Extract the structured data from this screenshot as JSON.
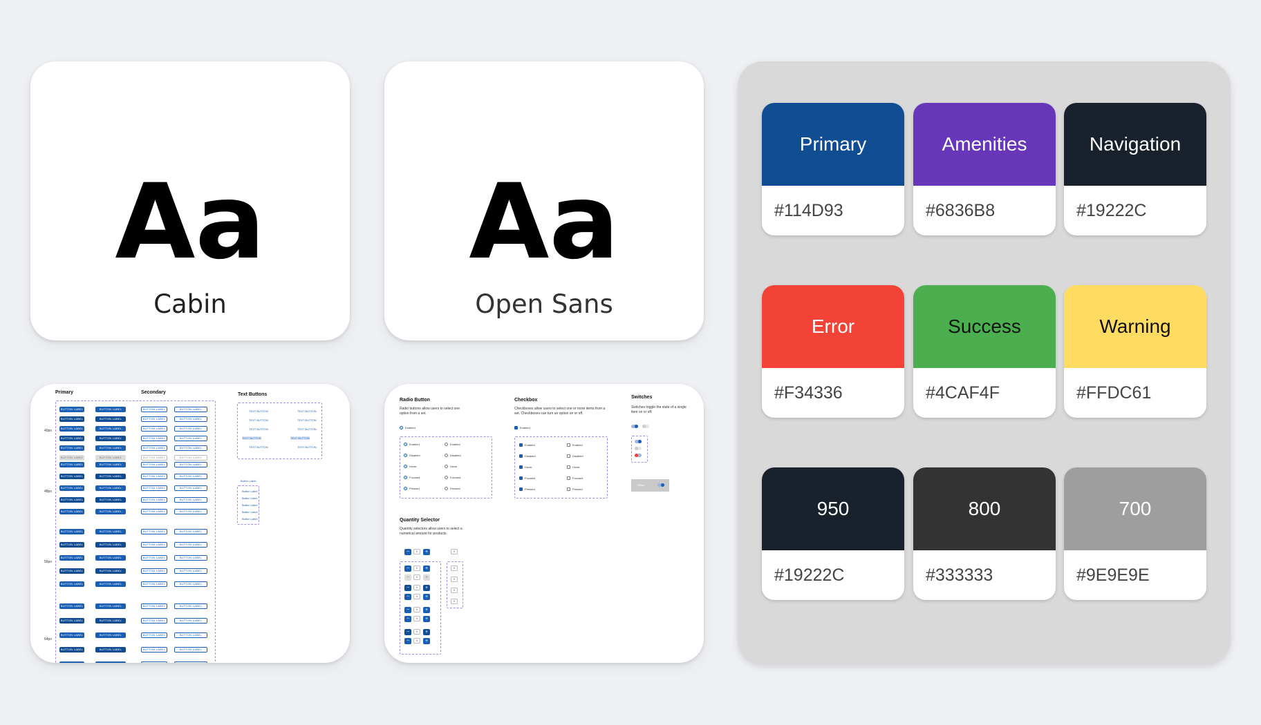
{
  "fonts": [
    {
      "sample": "Aa",
      "name": "Cabin"
    },
    {
      "sample": "Aa",
      "name": "Open Sans"
    }
  ],
  "colors": [
    {
      "name": "Primary",
      "hex": "#114D93",
      "bg": "#114D93",
      "fg": "#FFFFFF"
    },
    {
      "name": "Amenities",
      "hex": "#6836B8",
      "bg": "#6836B8",
      "fg": "#FFFFFF"
    },
    {
      "name": "Navigation",
      "hex": "#19222C",
      "bg": "#19222C",
      "fg": "#FFFFFF"
    },
    {
      "name": "Error",
      "hex": "#F34336",
      "bg": "#F34336",
      "fg": "#FFFFFF"
    },
    {
      "name": "Success",
      "hex": "#4CAF4F",
      "bg": "#4CAF4F",
      "fg": "#111111"
    },
    {
      "name": "Warning",
      "hex": "#FFDC61",
      "bg": "#FFDC61",
      "fg": "#111111"
    },
    {
      "name": "950",
      "hex": "#19222C",
      "bg": "#19222C",
      "fg": "#FFFFFF"
    },
    {
      "name": "800",
      "hex": "#333333",
      "bg": "#333333",
      "fg": "#FFFFFF"
    },
    {
      "name": "700",
      "hex": "#9E9E9E",
      "bg": "#9E9E9E",
      "fg": "#FFFFFF"
    }
  ],
  "buttons_sheet": {
    "primary_label": "Primary",
    "secondary_label": "Secondary",
    "text_buttons_label": "Text Buttons",
    "button_label": "BUTTON LABEL",
    "text_button_label": "TEXT BUTTON",
    "sizes": [
      "40px",
      "48px",
      "56px",
      "64px"
    ],
    "icon_label": "Button Label"
  },
  "controls_sheet": {
    "radio_title": "Radio Button",
    "radio_desc": "Radio buttons allow users to select one option from a set.",
    "checkbox_title": "Checkbox",
    "checkbox_desc": "Checkboxes allow users to select one or more items from a set. Checkboxes can turn an option on or off.",
    "switch_title": "Switches",
    "switch_desc": "Switches toggle the state of a single item on or off.",
    "qty_title": "Quantity Selector",
    "qty_desc": "Quantity selectors allow users to select a numerical amount for products.",
    "enabled": "Enabled",
    "states": [
      "Enabled",
      "Disabled",
      "Hover",
      "Focused",
      "Pressed"
    ],
    "switch_chip": "Offline",
    "qty_value": "0"
  }
}
